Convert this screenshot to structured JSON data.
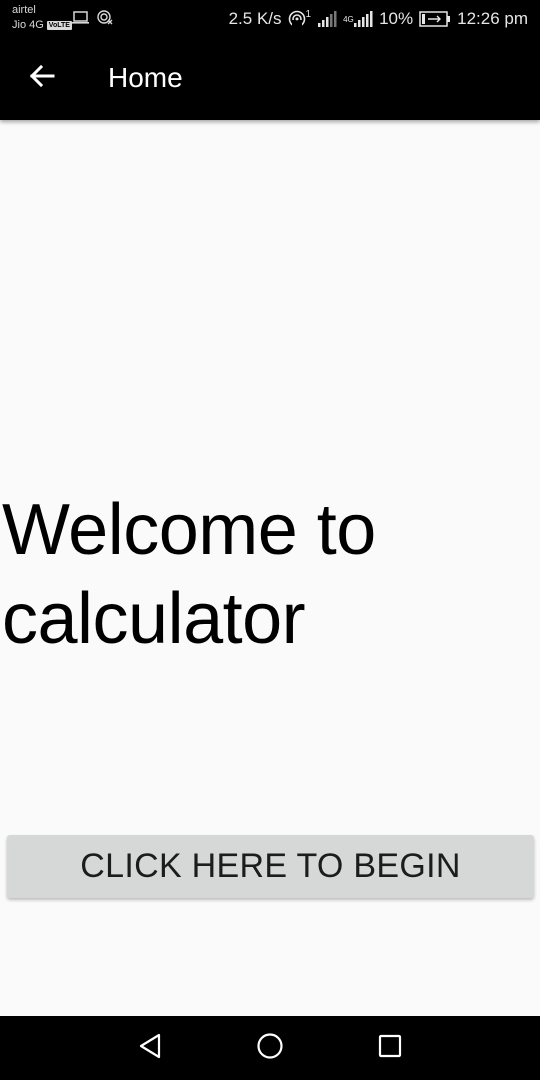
{
  "status_bar": {
    "carrier_1": "airtel",
    "carrier_2": "Jio 4G",
    "volte_badge": "VoLTE",
    "network_speed": "2.5 K/s",
    "hotspot_count": "1",
    "network_type": "4G",
    "battery_percent": "10%",
    "time": "12:26 pm",
    "icons": [
      "laptop-icon",
      "cast-off-icon",
      "hotspot-icon",
      "signal-icon-1",
      "signal-icon-2",
      "battery-icon"
    ]
  },
  "app_bar": {
    "back_icon": "arrow-left-icon",
    "title": "Home"
  },
  "main": {
    "welcome_line1": "Welcome to",
    "welcome_line2": "calculator",
    "begin_button_label": "CLICK HERE TO BEGIN"
  },
  "nav_bar": {
    "back_icon": "triangle-back-icon",
    "home_icon": "circle-home-icon",
    "recents_icon": "square-recents-icon"
  },
  "colors": {
    "bar_background": "#000000",
    "page_background": "#fafafa",
    "button_background": "#d6d7d7",
    "button_text": "#1c1c1c",
    "text_primary": "#000000"
  }
}
